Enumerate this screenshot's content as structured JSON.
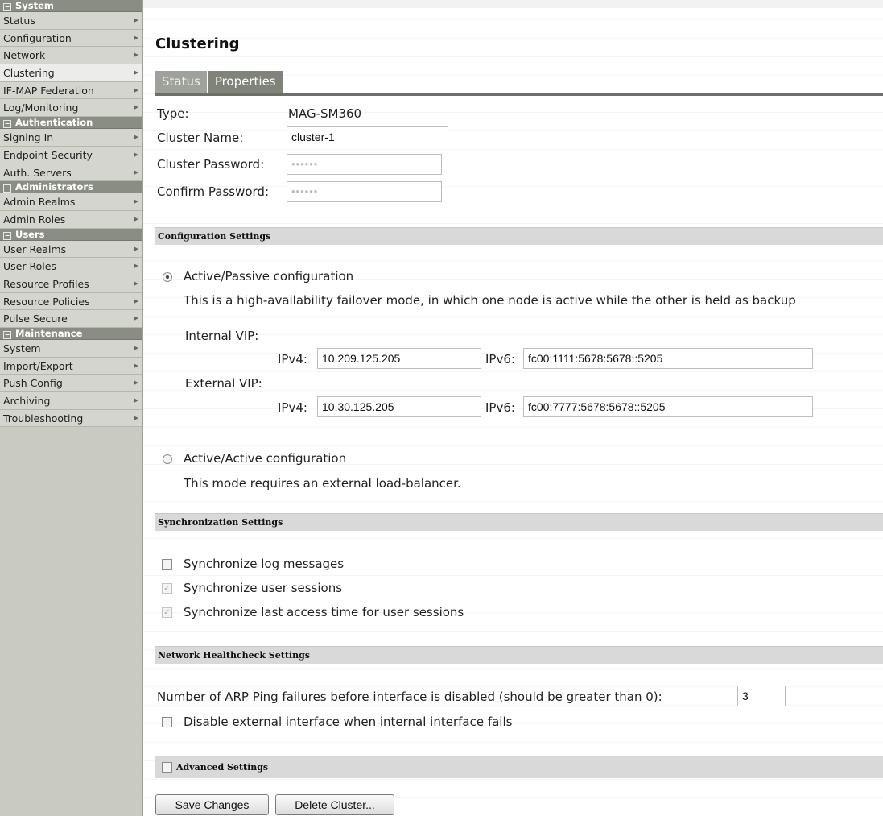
{
  "sidebar": {
    "sections": [
      {
        "title": "System",
        "items": [
          "Status",
          "Configuration",
          "Network",
          "Clustering",
          "IF-MAP Federation",
          "Log/Monitoring"
        ]
      },
      {
        "title": "Authentication",
        "items": [
          "Signing In",
          "Endpoint Security",
          "Auth. Servers"
        ]
      },
      {
        "title": "Administrators",
        "items": [
          "Admin Realms",
          "Admin Roles"
        ]
      },
      {
        "title": "Users",
        "items": [
          "User Realms",
          "User Roles",
          "Resource Profiles",
          "Resource Policies",
          "Pulse Secure"
        ]
      },
      {
        "title": "Maintenance",
        "items": [
          "System",
          "Import/Export",
          "Push Config",
          "Archiving",
          "Troubleshooting"
        ]
      }
    ],
    "active_item": "Clustering"
  },
  "page": {
    "title": "Clustering",
    "tabs": [
      "Status",
      "Properties"
    ],
    "active_tab": "Properties"
  },
  "form": {
    "type_label": "Type:",
    "type_value": "MAG-SM360",
    "cluster_name_label": "Cluster Name:",
    "cluster_name_value": "cluster-1",
    "cluster_password_label": "Cluster Password:",
    "cluster_password_value": "••••••",
    "confirm_password_label": "Confirm Password:",
    "confirm_password_value": "••••••"
  },
  "config_settings": {
    "header": "Configuration Settings",
    "active_passive_label": "Active/Passive configuration",
    "active_passive_desc": "This is a high-availability failover mode, in which one node is active while the other is held as backup",
    "active_passive_selected": true,
    "internal_vip_label": "Internal VIP:",
    "external_vip_label": "External VIP:",
    "ipv4_label": "IPv4:",
    "ipv6_label": "IPv6:",
    "internal_ipv4": "10.209.125.205",
    "internal_ipv6": "fc00:1111:5678:5678::5205",
    "external_ipv4": "10.30.125.205",
    "external_ipv6": "fc00:7777:5678:5678::5205",
    "active_active_label": "Active/Active configuration",
    "active_active_desc": "This mode requires an external load-balancer.",
    "active_active_selected": false
  },
  "sync_settings": {
    "header": "Synchronization Settings",
    "options": [
      {
        "label": "Synchronize log messages",
        "checked": false,
        "disabled": false
      },
      {
        "label": "Synchronize user sessions",
        "checked": true,
        "disabled": true
      },
      {
        "label": "Synchronize last access time for user sessions",
        "checked": true,
        "disabled": true
      }
    ]
  },
  "healthcheck": {
    "header": "Network Healthcheck Settings",
    "arp_label": "Number of ARP Ping failures before interface is disabled (should be greater than 0):",
    "arp_value": "3",
    "disable_external_label": "Disable external interface when internal interface fails",
    "disable_external_checked": false
  },
  "advanced": {
    "label": "Advanced Settings",
    "checked": false
  },
  "buttons": {
    "save": "Save Changes",
    "delete": "Delete Cluster..."
  }
}
